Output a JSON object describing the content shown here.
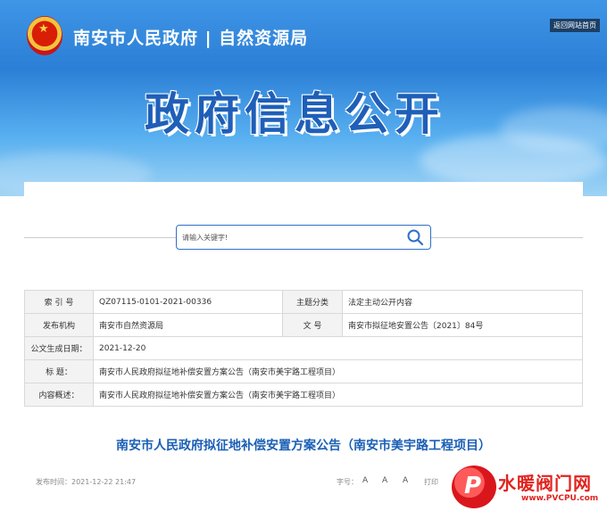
{
  "header": {
    "site_title": "南安市人民政府 | 自然资源局",
    "back_home_label": "返回网站首页",
    "headline": "政府信息公开"
  },
  "search": {
    "placeholder": "请输入关键字!"
  },
  "info": {
    "index_label": "索 引 号",
    "index_value": "QZ07115-0101-2021-00336",
    "topic_label": "主题分类",
    "topic_value": "法定主动公开内容",
    "issuer_label": "发布机构",
    "issuer_value": "南安市自然资源局",
    "docno_label": "文 号",
    "docno_value": "南安市拟征地安置公告〔2021〕84号",
    "date_label": "公文生成日期：",
    "date_value": "2021-12-20",
    "title_label": "标 题：",
    "title_value": "南安市人民政府拟征地补偿安置方案公告（南安市美宇路工程项目）",
    "summary_label": "内容概述：",
    "summary_value": "南安市人民政府拟征地补偿安置方案公告（南安市美宇路工程项目）"
  },
  "article": {
    "title": "南安市人民政府拟征地补偿安置方案公告（南安市美宇路工程项目）",
    "publish_time": "发布时间：2021-12-22 21:47",
    "font_size_label": "字号：",
    "font_large": "A",
    "font_medium": "A",
    "font_small": "A",
    "print_label": "打印"
  },
  "watermark": {
    "logo_letter": "P",
    "name": "水暖阀门网",
    "url": "www.PVCPU.com"
  },
  "colors": {
    "accent": "#1b5fb5",
    "banner": "#2b7fd6",
    "watermark": "#e1241f"
  }
}
